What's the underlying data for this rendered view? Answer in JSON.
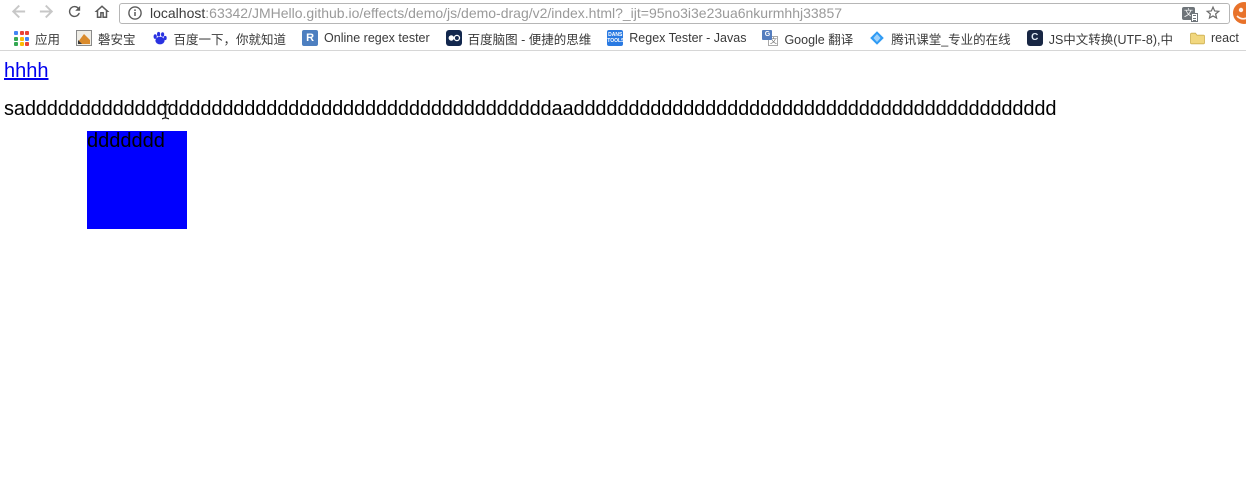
{
  "browser": {
    "omnibox": {
      "host": "localhost",
      "path": ":63342/JMHello.github.io/effects/demo/js/demo-drag/v2/index.html?_ijt=95no3i3e23ua6nkurmhhj33857"
    },
    "bookmarks": [
      {
        "label": "应用",
        "icon": "apps-grid-icon"
      },
      {
        "label": "磬安宝",
        "icon": "cat-photo-icon"
      },
      {
        "label": "百度一下，你就知道",
        "icon": "baidu-paw-icon"
      },
      {
        "label": "Online regex tester",
        "icon": "letter-r-icon"
      },
      {
        "label": "百度脑图 - 便捷的思维",
        "icon": "baidu-naotu-icon"
      },
      {
        "label": "Regex Tester - Javas",
        "icon": "danstools-icon"
      },
      {
        "label": "Google 翻译",
        "icon": "google-translate-icon"
      },
      {
        "label": "腾讯课堂_专业的在线",
        "icon": "tencent-classroom-icon"
      },
      {
        "label": "JS中文转换(UTF-8),中",
        "icon": "js-converter-icon"
      },
      {
        "label": "react",
        "icon": "folder-icon"
      }
    ]
  },
  "page": {
    "link_text": "hhhh",
    "body_text": "saddddddddddddddddddddddddddddddddddddddddddddddddaadddddddddddddddddddddddddddddddddddddddddddd",
    "box_label": "ddddddd"
  },
  "colors": {
    "box_blue": "#0000ff",
    "link_blue": "#0000ee",
    "avatar_orange": "#e8722a",
    "baidu_blue": "#2932e1",
    "bookmark_border": "#d6d6d6"
  }
}
